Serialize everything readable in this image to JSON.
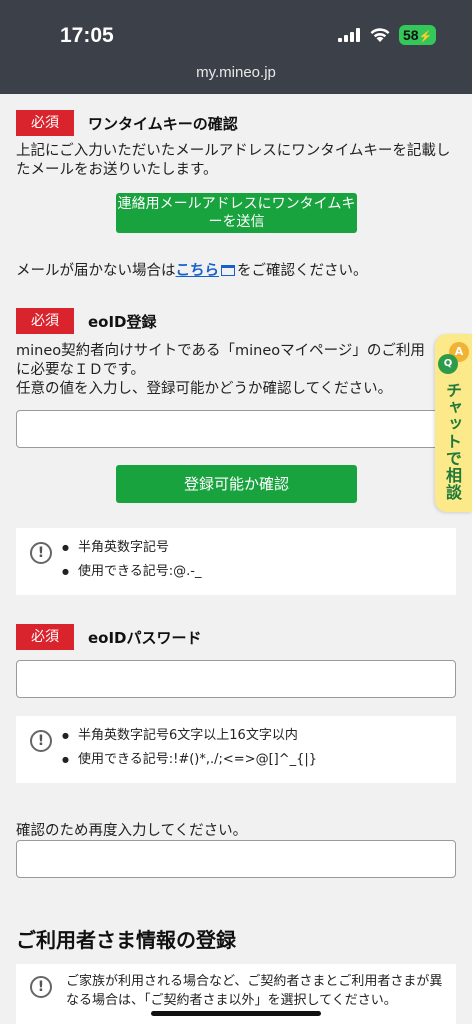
{
  "status": {
    "time": "17:05",
    "battery": "58"
  },
  "browser": {
    "url": "my.mineo.jp"
  },
  "required_label": "必須",
  "onetime": {
    "title": "ワンタイムキーの確認",
    "description": "上記にご入力いただいたメールアドレスにワンタイムキーを記載したメールをお送りいたします。",
    "send_button": "連絡用メールアドレスにワンタイムキーを送信",
    "notice_before": "メールが届かない場合は",
    "notice_link": "こちら",
    "notice_after": "をご確認ください。"
  },
  "eoid": {
    "title": "eoID登録",
    "description": "mineo契約者向けサイトである「mineoマイページ」のご利用に必要なＩＤです。\n任意の値を入力し、登録可能かどうか確認してください。",
    "input_value": "",
    "check_button": "登録可能か確認",
    "rules": [
      "半角英数字記号",
      "使用できる記号:@.-_"
    ]
  },
  "password": {
    "title": "eoIDパスワード",
    "input_value": "",
    "rules": [
      "半角英数字記号6文字以上16文字以内",
      "使用できる記号:!#()*,./;<=>@[]^_{|}"
    ],
    "confirm_label": "確認のため再度入力してください。",
    "confirm_value": ""
  },
  "user_info": {
    "title": "ご利用者さま情報の登録",
    "note": "ご家族が利用される場合など、ご契約者さまとご利用者さまが異なる場合は、「ご契約者さま以外」を選択してください。"
  },
  "chat": {
    "label": "チャットで相談",
    "icon_a": "A",
    "icon_q": "Q"
  },
  "colors": {
    "accent_green": "#18a33f",
    "required_red": "#d9232d",
    "link_blue": "#1560c9",
    "chat_yellow": "#fbe98a"
  }
}
